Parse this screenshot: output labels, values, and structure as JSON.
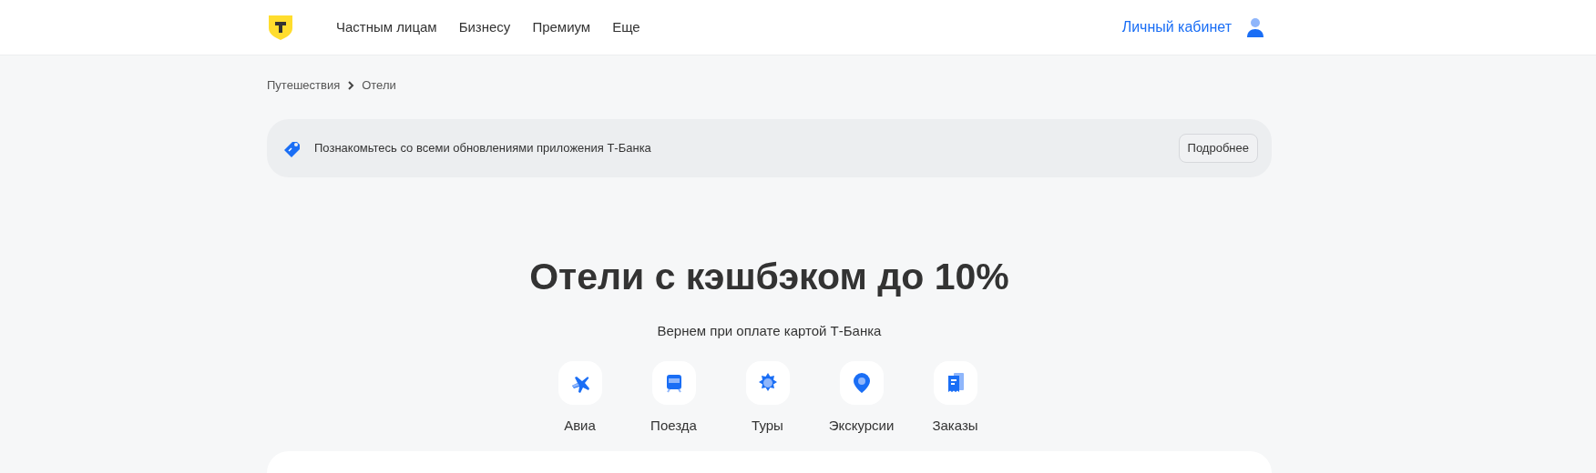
{
  "header": {
    "nav": [
      "Частным лицам",
      "Бизнесу",
      "Премиум",
      "Еще"
    ],
    "account": "Личный кабинет"
  },
  "breadcrumbs": [
    "Путешествия",
    "Отели"
  ],
  "banner": {
    "text": "Познакомьтесь со всеми обновлениями приложения Т-Банка",
    "button": "Подробнее"
  },
  "hero": {
    "title": "Отели с кэшбэком до 10%",
    "subtitle": "Вернем при оплате картой Т-Банка"
  },
  "categories": [
    {
      "kind": "plane",
      "label": "Авиа"
    },
    {
      "kind": "train",
      "label": "Поезда"
    },
    {
      "kind": "sun",
      "label": "Туры"
    },
    {
      "kind": "pin",
      "label": "Экскурсии"
    },
    {
      "kind": "receipt",
      "label": "Заказы"
    }
  ]
}
